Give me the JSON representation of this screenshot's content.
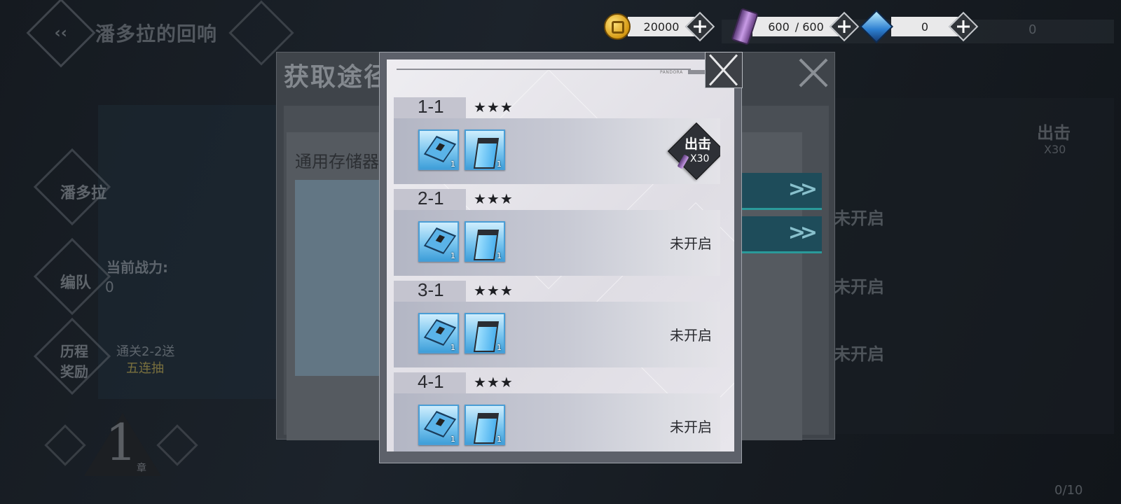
{
  "background": {
    "event_title": "潘多拉的回响",
    "menu": {
      "pandora_label": "潘多拉",
      "team_label": "编队",
      "power_label": "当前战力:",
      "power_value": "0",
      "rewards_label": "历程奖励",
      "rewards_hint": "通关2-2送",
      "rewards_highlight": "五连抽"
    },
    "chapter_number": "1",
    "chapter_suffix": "章",
    "progress": "0/10",
    "right_rows": [
      "未开启",
      "未开启",
      "未开启"
    ],
    "right_sortie_label": "出击",
    "right_sortie_cost": "X30",
    "right_counter": "0"
  },
  "underlying_dialog": {
    "title": "获取途径",
    "item_label": "通用存储器"
  },
  "resources": {
    "gold": "20000",
    "stamina_current": "600",
    "stamina_max": "/ 600",
    "gems": "0"
  },
  "modal": {
    "brand": "PANDORA",
    "stages": [
      {
        "name": "1-1",
        "stars": "★★★",
        "items": [
          {
            "icon": "chip-icon",
            "count": "1"
          },
          {
            "icon": "storage-box-icon",
            "count": "1"
          }
        ],
        "unlocked": true,
        "sortie_label": "出击",
        "sortie_cost": "X30",
        "status": ""
      },
      {
        "name": "2-1",
        "stars": "★★★",
        "items": [
          {
            "icon": "chip-icon",
            "count": "1"
          },
          {
            "icon": "storage-box-icon",
            "count": "1"
          }
        ],
        "unlocked": false,
        "status": "未开启"
      },
      {
        "name": "3-1",
        "stars": "★★★",
        "items": [
          {
            "icon": "chip-icon",
            "count": "1"
          },
          {
            "icon": "storage-box-icon",
            "count": "1"
          }
        ],
        "unlocked": false,
        "status": "未开启"
      },
      {
        "name": "4-1",
        "stars": "★★★",
        "items": [
          {
            "icon": "chip-icon",
            "count": "1"
          },
          {
            "icon": "storage-box-icon",
            "count": "1"
          }
        ],
        "unlocked": false,
        "status": "未开启"
      }
    ]
  }
}
